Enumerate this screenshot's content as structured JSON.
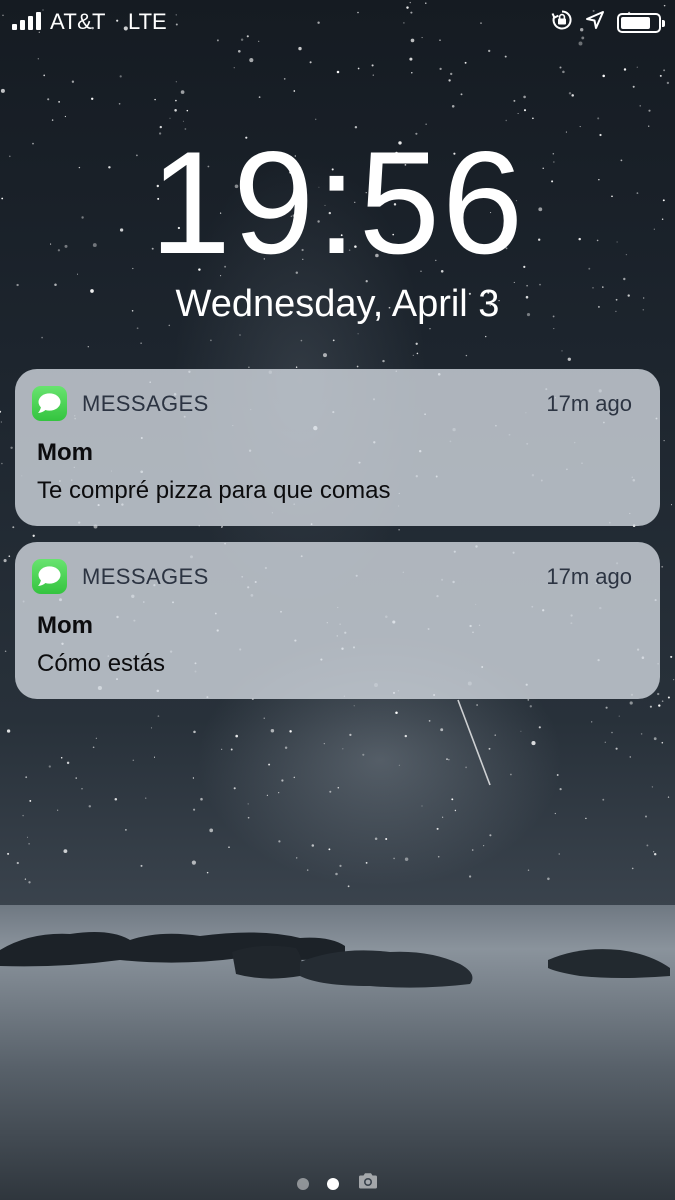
{
  "status_bar": {
    "carrier": "AT&T",
    "network": "LTE",
    "signal_bars": 4,
    "battery_level": 0.82,
    "icons": [
      "rotation-lock-icon",
      "location-arrow-icon",
      "battery-icon"
    ]
  },
  "lock_screen": {
    "time": "19:56",
    "date": "Wednesday, April 3"
  },
  "notifications": [
    {
      "app_name": "MESSAGES",
      "icon": "messages-app-icon",
      "time_ago": "17m ago",
      "sender": "Mom",
      "body": "Te compré pizza para que comas"
    },
    {
      "app_name": "MESSAGES",
      "icon": "messages-app-icon",
      "time_ago": "17m ago",
      "sender": "Mom",
      "body": "Cómo estás"
    }
  ],
  "page_indicator": {
    "pages": 2,
    "active_page": 2,
    "icons": [
      "camera-icon"
    ]
  },
  "colors": {
    "accent_green": "#34c43f",
    "notification_bg": "#d2d8e0"
  }
}
